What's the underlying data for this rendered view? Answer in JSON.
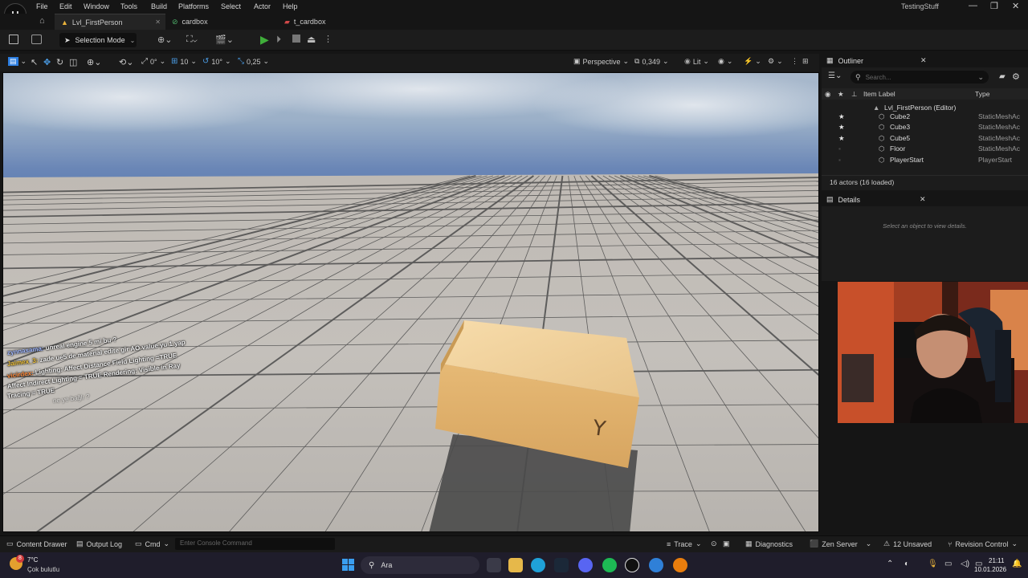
{
  "menu": [
    "File",
    "Edit",
    "Window",
    "Tools",
    "Build",
    "Platforms",
    "Select",
    "Actor",
    "Help"
  ],
  "project_name": "TestingStuff",
  "window_controls": {
    "minimize": "—",
    "restore": "❐",
    "close": "✕"
  },
  "tabs": [
    {
      "label": "Lvl_FirstPerson",
      "icon": "level-icon"
    },
    {
      "label": "cardbox",
      "icon": "material-icon"
    },
    {
      "label": "t_cardbox",
      "icon": "texture-icon"
    }
  ],
  "toolbar": {
    "selection_mode": "Selection Mode"
  },
  "viewport_toolbar": {
    "rot_snap": "0°",
    "grid_snap": "10",
    "rotate_snap": "10°",
    "scale_snap": "0,25",
    "view_mode": "Perspective",
    "camera_speed": "0,349",
    "lit": "Lit"
  },
  "outliner": {
    "title": "Outliner",
    "search_placeholder": "Search...",
    "col_label": "Item Label",
    "col_type": "Type",
    "root": "Lvl_FirstPerson (Editor)",
    "items": [
      {
        "name": "Cube2",
        "type": "StaticMeshAc",
        "starred": true
      },
      {
        "name": "Cube3",
        "type": "StaticMeshAc",
        "starred": true
      },
      {
        "name": "Cube5",
        "type": "StaticMeshAc",
        "starred": true
      },
      {
        "name": "Floor",
        "type": "StaticMeshAc",
        "starred": false
      },
      {
        "name": "PlayerStart",
        "type": "PlayerStart",
        "starred": false
      }
    ],
    "footer": "16 actors (16 loaded)"
  },
  "details": {
    "title": "Details",
    "empty_text": "Select an object to view details."
  },
  "chat": [
    {
      "user": "zynnasama:",
      "text": "unreal engine 5 mi bu ?"
    },
    {
      "user": "Jaimex_3:",
      "text": "zade ue5 de material edite gir AO value yu 1 yap"
    },
    {
      "user": "vicirdex:",
      "text": "Lighting: Affect Distance Field Lighting =TRUE"
    },
    {
      "user": "",
      "text": "Affect Indirect Lighting = TRUE Rendering: Visible in Ray"
    },
    {
      "user": "",
      "text": "Tracing = TRUE"
    },
    {
      "user": "",
      "text": "ne ye bağlı ?"
    }
  ],
  "statusbar": {
    "content_drawer": "Content Drawer",
    "output_log": "Output Log",
    "cmd": "Cmd",
    "console_placeholder": "Enter Console Command",
    "trace": "Trace",
    "diagnostics": "Diagnostics",
    "zen_server": "Zen Server",
    "unsaved": "12 Unsaved",
    "revision_control": "Revision Control"
  },
  "taskbar": {
    "weather_temp": "7°C",
    "weather_desc": "Çok bulutlu",
    "search_label": "Ara",
    "time": "21:11",
    "date": "10.01.2026",
    "notif_badge": "8"
  },
  "colors": {
    "play": "#3fae3a",
    "accent": "#2b7de0",
    "star": "#e6e6e6",
    "taskbar": "#1f1d2b"
  }
}
